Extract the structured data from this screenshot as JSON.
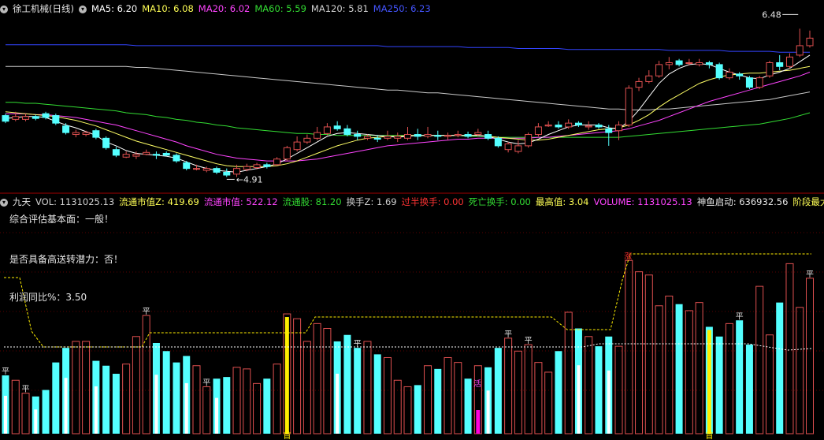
{
  "colors": {
    "up": "#e05050",
    "down": "#54ffff",
    "ma5": "#ffffff",
    "ma10": "#ffff66",
    "ma20": "#ff44ff",
    "ma60": "#33dd33",
    "ma120": "#c9c9c9",
    "ma250": "#3344ff"
  },
  "top_header": {
    "stock": "徐工机械(日线)",
    "items": [
      {
        "text": "MA5: 6.20",
        "color": "#ffffff"
      },
      {
        "text": "MA10: 6.08",
        "color": "#ffff55"
      },
      {
        "text": "MA20: 6.02",
        "color": "#ff44ff"
      },
      {
        "text": "MA60: 5.59",
        "color": "#33dd33"
      },
      {
        "text": "MA120: 5.81",
        "color": "#d0d0d0"
      },
      {
        "text": "MA250: 6.23",
        "color": "#4455ff"
      }
    ]
  },
  "price_annotations": {
    "high": "6.48",
    "low": "4.91"
  },
  "indicator_header": {
    "name": "九天",
    "items": [
      {
        "text": "VOL: 1131025.13",
        "color": "#d0d0d0"
      },
      {
        "text": "流通市值Z: 419.69",
        "color": "#ffff55"
      },
      {
        "text": "流通市值: 522.12",
        "color": "#ff44ff"
      },
      {
        "text": "流通股: 81.20",
        "color": "#33dd33"
      },
      {
        "text": "换手Z: 1.69",
        "color": "#d0d0d0"
      },
      {
        "text": "过半换手: 0.00",
        "color": "#ff3333"
      },
      {
        "text": "死亡换手: 0.00",
        "color": "#33dd33"
      },
      {
        "text": "最高值: 3.04",
        "color": "#ffff55"
      },
      {
        "text": "VOLUME: 1131025.13",
        "color": "#ff44ff"
      },
      {
        "text": "神鱼启动: 636932.56",
        "color": "#e6e6e6"
      },
      {
        "text": "阶段最大多方",
        "color": "#ffff55"
      }
    ]
  },
  "info": {
    "line1": "综合评估基本面：一般！",
    "line2": "是否具备高送转潜力：否！",
    "line3": "利润同比%：3.50"
  },
  "marks": {
    "ping": "平",
    "huo": "活",
    "zhang": "涨",
    "shou": "首"
  },
  "chart_data": {
    "type": "candlestick",
    "candles": [
      [
        5.56,
        5.5,
        5.58,
        5.48
      ],
      [
        5.52,
        5.55,
        5.6,
        5.5
      ],
      [
        5.52,
        5.55,
        5.58,
        5.5
      ],
      [
        5.55,
        5.53,
        5.57,
        5.51
      ],
      [
        5.58,
        5.54,
        5.6,
        5.52
      ],
      [
        5.56,
        5.48,
        5.58,
        5.46
      ],
      [
        5.45,
        5.38,
        5.48,
        5.36
      ],
      [
        5.36,
        5.38,
        5.41,
        5.33
      ],
      [
        5.36,
        5.38,
        5.4,
        5.34
      ],
      [
        5.4,
        5.33,
        5.42,
        5.31
      ],
      [
        5.32,
        5.22,
        5.34,
        5.2
      ],
      [
        5.2,
        5.14,
        5.23,
        5.12
      ],
      [
        5.12,
        5.15,
        5.18,
        5.11
      ],
      [
        5.13,
        5.15,
        5.18,
        5.1
      ],
      [
        5.15,
        5.17,
        5.2,
        5.14
      ],
      [
        5.15,
        5.14,
        5.18,
        5.1
      ],
      [
        5.16,
        5.14,
        5.18,
        5.13
      ],
      [
        5.14,
        5.08,
        5.16,
        5.06
      ],
      [
        5.06,
        5.0,
        5.08,
        4.98
      ],
      [
        5.0,
        5.0,
        5.04,
        4.98
      ],
      [
        4.98,
        5.0,
        5.02,
        4.96
      ],
      [
        5.0,
        4.96,
        5.02,
        4.94
      ],
      [
        4.96,
        4.93,
        5.0,
        4.91
      ],
      [
        4.94,
        5.0,
        5.04,
        4.91
      ],
      [
        4.99,
        5.02,
        5.05,
        4.97
      ],
      [
        5.01,
        5.04,
        5.06,
        4.99
      ],
      [
        5.04,
        5.02,
        5.06,
        5.0
      ],
      [
        5.04,
        5.1,
        5.12,
        5.03
      ],
      [
        5.1,
        5.22,
        5.24,
        5.08
      ],
      [
        5.2,
        5.28,
        5.34,
        5.18
      ],
      [
        5.28,
        5.32,
        5.36,
        5.26
      ],
      [
        5.32,
        5.38,
        5.44,
        5.3
      ],
      [
        5.37,
        5.44,
        5.48,
        5.35
      ],
      [
        5.45,
        5.42,
        5.5,
        5.4
      ],
      [
        5.42,
        5.36,
        5.46,
        5.34
      ],
      [
        5.36,
        5.34,
        5.4,
        5.3
      ],
      [
        5.32,
        5.34,
        5.36,
        5.3
      ],
      [
        5.32,
        5.31,
        5.35,
        5.28
      ],
      [
        5.32,
        5.34,
        5.4,
        5.3
      ],
      [
        5.32,
        5.34,
        5.38,
        5.28
      ],
      [
        5.32,
        5.36,
        5.44,
        5.3
      ],
      [
        5.36,
        5.34,
        5.42,
        5.3
      ],
      [
        5.34,
        5.36,
        5.44,
        5.32
      ],
      [
        5.35,
        5.34,
        5.4,
        5.3
      ],
      [
        5.34,
        5.35,
        5.38,
        5.3
      ],
      [
        5.35,
        5.36,
        5.4,
        5.33
      ],
      [
        5.36,
        5.34,
        5.39,
        5.32
      ],
      [
        5.36,
        5.38,
        5.42,
        5.34
      ],
      [
        5.36,
        5.32,
        5.4,
        5.3
      ],
      [
        5.32,
        5.24,
        5.34,
        5.22
      ],
      [
        5.2,
        5.26,
        5.28,
        5.17
      ],
      [
        5.18,
        5.24,
        5.3,
        5.16
      ],
      [
        5.24,
        5.36,
        5.38,
        5.22
      ],
      [
        5.36,
        5.44,
        5.48,
        5.34
      ],
      [
        5.45,
        5.46,
        5.5,
        5.44
      ],
      [
        5.46,
        5.44,
        5.5,
        5.42
      ],
      [
        5.44,
        5.48,
        5.52,
        5.42
      ],
      [
        5.48,
        5.46,
        5.5,
        5.44
      ],
      [
        5.44,
        5.45,
        5.5,
        5.41
      ],
      [
        5.46,
        5.44,
        5.48,
        5.42
      ],
      [
        5.42,
        5.38,
        5.46,
        5.24
      ],
      [
        5.4,
        5.46,
        5.5,
        5.3
      ],
      [
        5.46,
        5.85,
        5.88,
        5.44
      ],
      [
        5.86,
        5.92,
        5.96,
        5.82
      ],
      [
        5.92,
        5.98,
        6.04,
        5.9
      ],
      [
        5.98,
        6.1,
        6.14,
        5.96
      ],
      [
        6.1,
        6.12,
        6.18,
        6.05
      ],
      [
        6.14,
        6.1,
        6.16,
        6.08
      ],
      [
        6.12,
        6.12,
        6.16,
        6.09
      ],
      [
        6.1,
        6.12,
        6.16,
        6.08
      ],
      [
        6.12,
        6.1,
        6.14,
        6.06
      ],
      [
        6.1,
        5.96,
        6.12,
        5.94
      ],
      [
        5.96,
        6.02,
        6.06,
        5.94
      ],
      [
        6.0,
        5.98,
        6.02,
        5.94
      ],
      [
        5.96,
        5.86,
        5.98,
        5.84
      ],
      [
        5.86,
        5.96,
        5.98,
        5.84
      ],
      [
        5.98,
        6.12,
        6.14,
        5.96
      ],
      [
        6.12,
        6.08,
        6.2,
        6.04
      ],
      [
        6.08,
        6.18,
        6.22,
        6.06
      ],
      [
        6.2,
        6.3,
        6.48,
        6.18
      ],
      [
        6.3,
        6.38,
        6.46,
        6.28
      ]
    ],
    "ma": {
      "ma5": [
        5.53,
        5.54,
        5.55,
        5.55,
        5.54,
        5.5,
        5.46,
        5.43,
        5.39,
        5.35,
        5.28,
        5.24,
        5.19,
        5.16,
        5.15,
        5.14,
        5.13,
        5.11,
        5.07,
        5.03,
        5.0,
        4.98,
        4.97,
        4.96,
        4.98,
        5.0,
        5.02,
        5.05,
        5.1,
        5.16,
        5.22,
        5.28,
        5.34,
        5.37,
        5.38,
        5.37,
        5.36,
        5.35,
        5.34,
        5.33,
        5.34,
        5.35,
        5.35,
        5.35,
        5.35,
        5.35,
        5.35,
        5.35,
        5.34,
        5.31,
        5.28,
        5.26,
        5.27,
        5.31,
        5.36,
        5.4,
        5.44,
        5.46,
        5.46,
        5.46,
        5.43,
        5.42,
        5.5,
        5.62,
        5.76,
        5.9,
        6.0,
        6.06,
        6.1,
        6.11,
        6.1,
        6.06,
        6.02,
        5.99,
        5.96,
        5.95,
        5.99,
        6.02,
        6.06,
        6.13,
        6.2
      ],
      "ma10": [
        5.6,
        5.59,
        5.58,
        5.57,
        5.56,
        5.55,
        5.53,
        5.51,
        5.48,
        5.45,
        5.41,
        5.37,
        5.33,
        5.29,
        5.26,
        5.23,
        5.2,
        5.17,
        5.14,
        5.11,
        5.08,
        5.05,
        5.03,
        5.02,
        5.02,
        5.02,
        5.02,
        5.03,
        5.05,
        5.08,
        5.12,
        5.16,
        5.2,
        5.24,
        5.27,
        5.3,
        5.32,
        5.33,
        5.34,
        5.34,
        5.35,
        5.35,
        5.35,
        5.35,
        5.35,
        5.35,
        5.35,
        5.35,
        5.34,
        5.33,
        5.32,
        5.31,
        5.3,
        5.3,
        5.31,
        5.33,
        5.35,
        5.37,
        5.39,
        5.41,
        5.42,
        5.43,
        5.46,
        5.51,
        5.57,
        5.65,
        5.72,
        5.78,
        5.84,
        5.9,
        5.94,
        5.97,
        5.99,
        6.0,
        6.01,
        6.01,
        6.02,
        6.03,
        6.04,
        6.06,
        6.08
      ],
      "ma20": [
        5.58,
        5.58,
        5.58,
        5.57,
        5.57,
        5.56,
        5.55,
        5.54,
        5.52,
        5.5,
        5.48,
        5.46,
        5.43,
        5.4,
        5.37,
        5.34,
        5.31,
        5.28,
        5.24,
        5.21,
        5.18,
        5.15,
        5.13,
        5.11,
        5.1,
        5.09,
        5.08,
        5.08,
        5.08,
        5.08,
        5.09,
        5.1,
        5.12,
        5.14,
        5.16,
        5.18,
        5.2,
        5.22,
        5.24,
        5.25,
        5.26,
        5.27,
        5.28,
        5.29,
        5.3,
        5.31,
        5.31,
        5.32,
        5.32,
        5.32,
        5.32,
        5.32,
        5.32,
        5.33,
        5.33,
        5.34,
        5.35,
        5.36,
        5.37,
        5.38,
        5.39,
        5.4,
        5.42,
        5.45,
        5.48,
        5.51,
        5.55,
        5.59,
        5.63,
        5.67,
        5.71,
        5.74,
        5.77,
        5.8,
        5.83,
        5.86,
        5.89,
        5.92,
        5.95,
        5.98,
        6.02
      ],
      "ma60": [
        5.7,
        5.7,
        5.69,
        5.69,
        5.68,
        5.67,
        5.66,
        5.65,
        5.64,
        5.63,
        5.62,
        5.61,
        5.59,
        5.58,
        5.57,
        5.55,
        5.54,
        5.52,
        5.51,
        5.49,
        5.48,
        5.46,
        5.45,
        5.43,
        5.42,
        5.41,
        5.4,
        5.39,
        5.38,
        5.37,
        5.37,
        5.36,
        5.36,
        5.35,
        5.35,
        5.35,
        5.35,
        5.35,
        5.35,
        5.35,
        5.35,
        5.35,
        5.35,
        5.35,
        5.35,
        5.35,
        5.34,
        5.34,
        5.34,
        5.33,
        5.33,
        5.33,
        5.33,
        5.33,
        5.33,
        5.33,
        5.33,
        5.33,
        5.33,
        5.33,
        5.33,
        5.33,
        5.34,
        5.35,
        5.36,
        5.37,
        5.38,
        5.39,
        5.4,
        5.41,
        5.42,
        5.43,
        5.44,
        5.45,
        5.46,
        5.47,
        5.49,
        5.51,
        5.53,
        5.56,
        5.59
      ],
      "ma120": [
        6.08,
        6.08,
        6.08,
        6.08,
        6.08,
        6.08,
        6.08,
        6.08,
        6.08,
        6.08,
        6.08,
        6.08,
        6.08,
        6.07,
        6.07,
        6.06,
        6.05,
        6.04,
        6.03,
        6.02,
        6.01,
        6.0,
        5.99,
        5.98,
        5.97,
        5.96,
        5.95,
        5.94,
        5.93,
        5.92,
        5.91,
        5.9,
        5.89,
        5.88,
        5.87,
        5.86,
        5.85,
        5.84,
        5.83,
        5.83,
        5.82,
        5.81,
        5.8,
        5.8,
        5.79,
        5.78,
        5.77,
        5.76,
        5.75,
        5.74,
        5.73,
        5.72,
        5.71,
        5.7,
        5.69,
        5.68,
        5.67,
        5.66,
        5.65,
        5.64,
        5.63,
        5.63,
        5.62,
        5.62,
        5.62,
        5.63,
        5.63,
        5.64,
        5.65,
        5.66,
        5.67,
        5.68,
        5.69,
        5.7,
        5.71,
        5.72,
        5.73,
        5.75,
        5.77,
        5.79,
        5.81
      ],
      "ma250": [
        6.31,
        6.31,
        6.31,
        6.31,
        6.31,
        6.31,
        6.31,
        6.31,
        6.31,
        6.31,
        6.31,
        6.31,
        6.31,
        6.3,
        6.3,
        6.3,
        6.3,
        6.3,
        6.3,
        6.3,
        6.3,
        6.3,
        6.3,
        6.3,
        6.3,
        6.3,
        6.3,
        6.3,
        6.3,
        6.3,
        6.3,
        6.3,
        6.3,
        6.3,
        6.3,
        6.3,
        6.3,
        6.3,
        6.29,
        6.29,
        6.29,
        6.29,
        6.29,
        6.29,
        6.29,
        6.29,
        6.28,
        6.28,
        6.28,
        6.28,
        6.28,
        6.27,
        6.27,
        6.27,
        6.27,
        6.27,
        6.26,
        6.26,
        6.26,
        6.26,
        6.26,
        6.26,
        6.26,
        6.26,
        6.26,
        6.26,
        6.25,
        6.25,
        6.25,
        6.25,
        6.25,
        6.25,
        6.24,
        6.24,
        6.24,
        6.24,
        6.24,
        6.23,
        6.23,
        6.23,
        6.23
      ]
    },
    "volume": [
      0.36,
      0.33,
      0.25,
      0.23,
      0.27,
      0.44,
      0.53,
      0.57,
      0.57,
      0.45,
      0.42,
      0.37,
      0.43,
      0.6,
      0.73,
      0.56,
      0.51,
      0.44,
      0.48,
      0.42,
      0.29,
      0.34,
      0.35,
      0.41,
      0.4,
      0.31,
      0.34,
      0.43,
      0.74,
      0.71,
      0.57,
      0.68,
      0.65,
      0.57,
      0.61,
      0.53,
      0.57,
      0.49,
      0.47,
      0.33,
      0.29,
      0.3,
      0.42,
      0.4,
      0.47,
      0.44,
      0.34,
      0.42,
      0.41,
      0.53,
      0.59,
      0.51,
      0.55,
      0.44,
      0.38,
      0.51,
      0.75,
      0.65,
      0.6,
      0.54,
      0.6,
      0.54,
      1.07,
      1.0,
      0.98,
      0.79,
      0.85,
      0.8,
      0.76,
      0.81,
      0.66,
      0.6,
      0.68,
      0.7,
      0.55,
      0.91,
      0.61,
      0.81,
      1.05,
      0.78,
      0.96
    ],
    "vol_max": 1.12,
    "ylim": [
      4.78,
      6.6
    ]
  }
}
